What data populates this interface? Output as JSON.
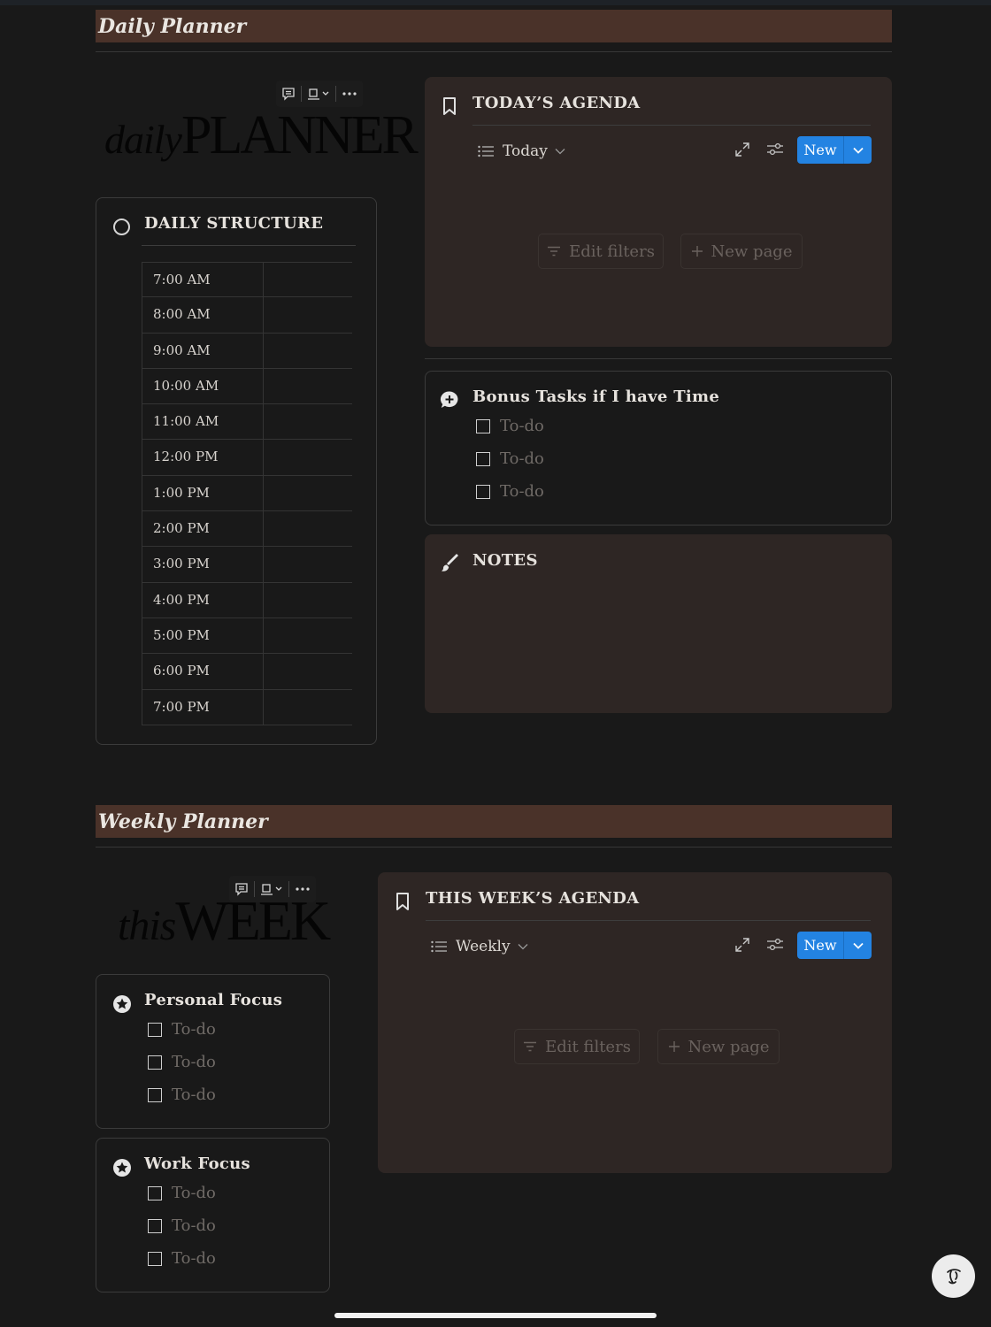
{
  "daily": {
    "section_title": "Daily Planner",
    "logo": {
      "script": "daily",
      "caps": "PLANNER"
    },
    "structure": {
      "title": "DAILY STRUCTURE",
      "times": [
        "7:00 AM",
        "8:00 AM",
        "9:00 AM",
        "10:00 AM",
        "11:00 AM",
        "12:00 PM",
        "1:00 PM",
        "2:00 PM",
        "3:00 PM",
        "4:00 PM",
        "5:00 PM",
        "6:00 PM",
        "7:00 PM"
      ]
    },
    "agenda": {
      "title": "TODAY’S AGENDA",
      "view_label": "Today",
      "new_label": "New",
      "edit_filters": "Edit filters",
      "new_page": "New page"
    },
    "bonus": {
      "title": "Bonus Tasks if I have Time",
      "todos": [
        "To-do",
        "To-do",
        "To-do"
      ]
    },
    "notes": {
      "title": "NOTES"
    }
  },
  "weekly": {
    "section_title": "Weekly Planner",
    "logo": {
      "script": "this",
      "caps": "WEEK"
    },
    "personal": {
      "title": "Personal Focus",
      "todos": [
        "To-do",
        "To-do",
        "To-do"
      ]
    },
    "work": {
      "title": "Work Focus",
      "todos": [
        "To-do",
        "To-do",
        "To-do"
      ]
    },
    "agenda": {
      "title": "THIS WEEK’S AGENDA",
      "view_label": "Weekly",
      "new_label": "New",
      "edit_filters": "Edit filters",
      "new_page": "New page"
    }
  },
  "colors": {
    "header_bar": "#4a3229",
    "card_fill": "#2e2624",
    "accent": "#2383e2",
    "background": "#191919"
  }
}
